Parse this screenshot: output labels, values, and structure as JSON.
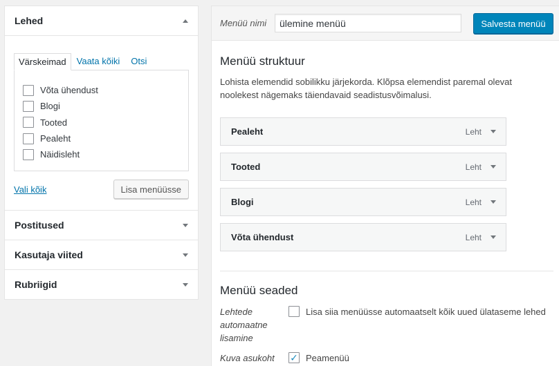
{
  "left": {
    "pages_title": "Lehed",
    "tabs": [
      "Värskeimad",
      "Vaata kõiki",
      "Otsi"
    ],
    "pages": [
      {
        "label": "Võta ühendust",
        "checked": false
      },
      {
        "label": "Blogi",
        "checked": false
      },
      {
        "label": "Tooted",
        "checked": false
      },
      {
        "label": "Pealeht",
        "checked": false
      },
      {
        "label": "Näidisleht",
        "checked": false
      }
    ],
    "select_all": "Vali kõik",
    "add_button": "Lisa menüüsse",
    "sections": [
      "Postitused",
      "Kasutaja viited",
      "Rubriigid"
    ]
  },
  "right": {
    "menu_name_label": "Menüü nimi",
    "menu_name_value": "ülemine menüü",
    "save_button": "Salvesta menüü",
    "structure_title": "Menüü struktuur",
    "structure_desc": "Lohista elemendid sobilikku järjekorda. Klõpsa elemendist paremal olevat noolekest nägemaks täiendavaid seadistusvõimalusi.",
    "items": [
      {
        "title": "Pealeht",
        "type": "Leht"
      },
      {
        "title": "Tooted",
        "type": "Leht"
      },
      {
        "title": "Blogi",
        "type": "Leht"
      },
      {
        "title": "Võta ühendust",
        "type": "Leht"
      }
    ],
    "settings_title": "Menüü seaded",
    "auto_add_label": "Lehtede automaatne lisamine",
    "auto_add_text": "Lisa siia menüüsse automaatselt kõik uued ülataseme lehed",
    "auto_add_checked": false,
    "location_label": "Kuva asukoht",
    "location_text": "Peamenüü",
    "location_checked": true
  },
  "colors": {
    "accent": "#0073aa",
    "primary_button": "#0085ba",
    "background": "#f1f1f1"
  }
}
